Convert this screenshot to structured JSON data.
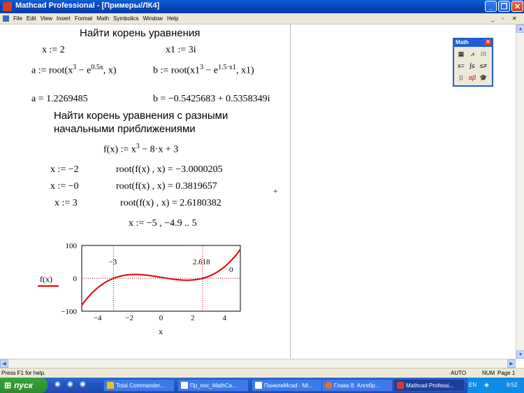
{
  "window": {
    "title": "Mathcad Professional - [Примеры/ЛК4]",
    "minimize_icon": "minimize-icon",
    "restore_icon": "restore-icon",
    "close_icon": "close-icon"
  },
  "menu": {
    "items": [
      "File",
      "Edit",
      "View",
      "Insert",
      "Format",
      "Math",
      "Symbolics",
      "Window",
      "Help"
    ],
    "right_controls": [
      "_",
      "▫",
      "✕"
    ]
  },
  "worksheet": {
    "heading1": "Найти корень уравнения",
    "x_def": "x := 2",
    "x1_def": "x1 := 3i",
    "a_def_pre": "a := root(x",
    "a_def_exp": "3",
    "a_def_mid": " − e",
    "a_def_exp2": "0.5x",
    "a_def_post": ", x)",
    "b_def_pre": "b := root(x1",
    "b_def_exp": "3",
    "b_def_mid": " − e",
    "b_def_exp2": "1.5·x1",
    "b_def_post": ", x1)",
    "a_result": "a = 1.2269485",
    "b_result": "b = −0.5425683 + 0.5358349i",
    "heading2_line1": "Найти корень уравнения с разными",
    "heading2_line2": "начальными приближениями",
    "f_def_pre": "f(x) := x",
    "f_def_exp": "3",
    "f_def_post": " − 8·x + 3",
    "rows": [
      {
        "assign": "x := −2",
        "result": "root(f(x) , x) = −3.0000205"
      },
      {
        "assign": "x := −0",
        "result": "root(f(x) , x) = 0.3819657"
      },
      {
        "assign": "x := 3",
        "result": "root(f(x) , x) = 2.6180382"
      }
    ],
    "range_def": "x := −5 , −4.9 .. 5",
    "cursor_glyph": "+"
  },
  "chart_data": {
    "type": "line",
    "function": "f(x) = x^3 - 8x + 3",
    "x_range": [
      -5,
      5
    ],
    "x_step": 0.1,
    "xlim": [
      -5,
      5
    ],
    "ylim": [
      -100,
      100
    ],
    "xticks": [
      "−4",
      "−2",
      "0",
      "2",
      "4"
    ],
    "yticks": [
      "100",
      "0",
      "−100"
    ],
    "xlabel": "x",
    "legend_label": "f(x)",
    "series_color": "#e00000",
    "vlines": [
      {
        "x": -3,
        "label": "−3"
      },
      {
        "x": 2.618,
        "label": "2.618"
      }
    ],
    "hline": {
      "y": 0,
      "label": "0"
    },
    "sample_points": [
      {
        "x": -5,
        "y": -82
      },
      {
        "x": -4,
        "y": -29
      },
      {
        "x": -3,
        "y": 0
      },
      {
        "x": -2,
        "y": 11
      },
      {
        "x": -1,
        "y": 10
      },
      {
        "x": 0,
        "y": 3
      },
      {
        "x": 1,
        "y": -4
      },
      {
        "x": 2,
        "y": -5
      },
      {
        "x": 3,
        "y": 6
      },
      {
        "x": 4,
        "y": 35
      },
      {
        "x": 5,
        "y": 88
      }
    ]
  },
  "palette": {
    "title": "Math",
    "buttons": [
      "▦",
      "⩘",
      "⁝⁝⁝",
      "x=",
      "∫≤",
      "≤≠",
      "⌷",
      "αβ",
      "🎓"
    ]
  },
  "statusbar": {
    "help": "Press F1 for help.",
    "mode": "AUTO",
    "num": "NUM",
    "page": "Page 1"
  },
  "taskbar": {
    "start": "пуск",
    "tasks": [
      "Total Commander...",
      "Пр_пос_MathCa...",
      "ПанелиMcad - Mi...",
      "Глава 8. Алгебр...",
      "Mathcad Professi..."
    ],
    "lang": "EN",
    "clock": "9:52"
  },
  "colors": {
    "title_bar": "#0a4fc8",
    "chrome": "#ece9d8",
    "start_button": "#2e8a2e",
    "plot_trace": "#e00000"
  }
}
